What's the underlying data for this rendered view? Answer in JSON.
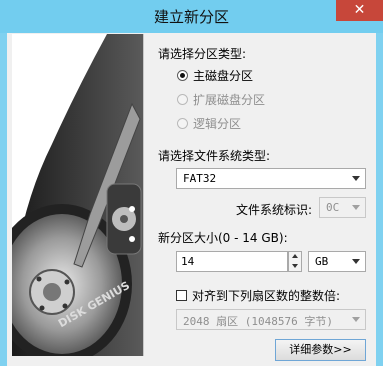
{
  "window": {
    "title": "建立新分区",
    "close_glyph": "✕"
  },
  "partition_type": {
    "label": "请选择分区类型:",
    "options": [
      {
        "label": "主磁盘分区",
        "checked": true,
        "enabled": true
      },
      {
        "label": "扩展磁盘分区",
        "checked": false,
        "enabled": false
      },
      {
        "label": "逻辑分区",
        "checked": false,
        "enabled": false
      }
    ]
  },
  "filesystem": {
    "label": "请选择文件系统类型:",
    "value": "FAT32",
    "id_label": "文件系统标识:",
    "id_value": "0C"
  },
  "size": {
    "label": "新分区大小(0 - 14 GB):",
    "value": "14",
    "unit": "GB"
  },
  "align": {
    "label": "对齐到下列扇区数的整数倍:",
    "checked": false,
    "value": "2048 扇区 (1048576 字节)"
  },
  "buttons": {
    "details": "详细参数>>"
  },
  "disk_image": {
    "brand_text": "DISK GENIUS"
  }
}
